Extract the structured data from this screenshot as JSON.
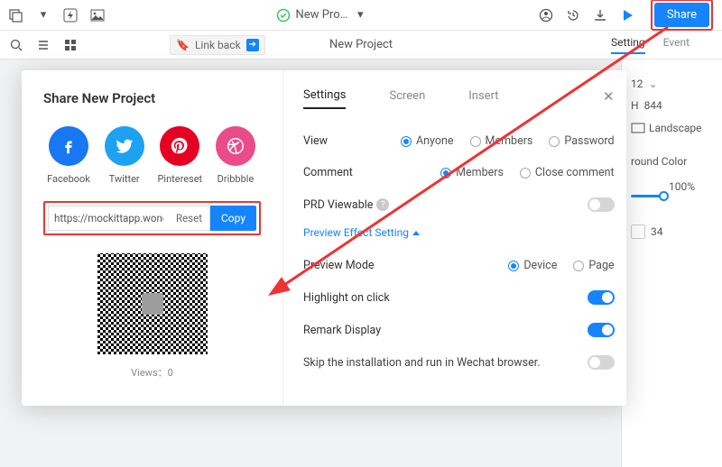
{
  "topbar": {
    "status_icon": "check-circle",
    "project_name": "New Pro…",
    "share_label": "Share"
  },
  "secondbar": {
    "link_back": "Link back",
    "project_title": "New Project",
    "tabs": {
      "setting": "Setting",
      "event": "Event"
    }
  },
  "side_panel": {
    "size_value": "12",
    "height_label": "H",
    "height_value": "844",
    "orientation_landscape": "Landscape",
    "bgcolor_label": "round Color",
    "opacity_pct": "100%",
    "count_value": "34"
  },
  "share_modal": {
    "title": "Share New Project",
    "socials": {
      "facebook": "Facebook",
      "twitter": "Twitter",
      "pinterest": "Pintereset",
      "dribbble": "Dribbble"
    },
    "url_value": "https://mockittapp.wonders",
    "reset_label": "Reset",
    "copy_label": "Copy",
    "views_label": "Views：0",
    "tabs": {
      "settings": "Settings",
      "screen": "Screen",
      "insert": "Insert"
    },
    "rows": {
      "view_label": "View",
      "view_options": {
        "anyone": "Anyone",
        "members": "Members",
        "password": "Password"
      },
      "view_selected": "anyone",
      "comment_label": "Comment",
      "comment_options": {
        "members": "Members",
        "close": "Close comment"
      },
      "comment_selected": "members",
      "prd_label": "PRD Viewable",
      "preview_effect_link": "Preview Effect Setting",
      "preview_mode_label": "Preview Mode",
      "preview_mode_options": {
        "device": "Device",
        "page": "Page"
      },
      "preview_mode_selected": "device",
      "highlight_label": "Highlight on click",
      "remark_label": "Remark Display",
      "wechat_label": "Skip the installation and run in Wechat browser."
    }
  }
}
